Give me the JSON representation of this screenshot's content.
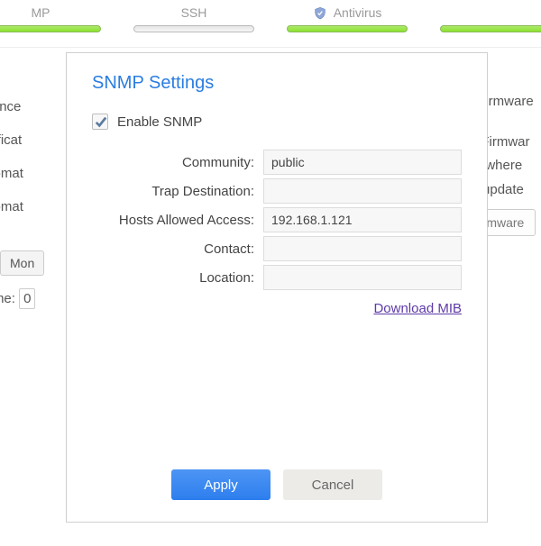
{
  "bg": {
    "tabs": [
      {
        "label": "MP",
        "bar": "green"
      },
      {
        "label": "SSH",
        "bar": "gray"
      },
      {
        "label": "Antivirus",
        "bar": "green",
        "icon": true
      },
      {
        "label": "",
        "bar": "green"
      }
    ],
    "left_items": [
      "tenance",
      "Notificat",
      "Automat",
      "Automat"
    ],
    "right_lines": [
      "all Firmware",
      "tall Firmwar",
      "tion where",
      "the update"
    ],
    "right_button": "Firmware",
    "day_pill": "Mon",
    "time_label": "Time:",
    "time_value": "0"
  },
  "modal": {
    "title": "SNMP Settings",
    "enable_label": "Enable SNMP",
    "enable_checked": true,
    "fields": {
      "community": {
        "label": "Community:",
        "value": "public"
      },
      "trap": {
        "label": "Trap Destination:",
        "value": ""
      },
      "hosts": {
        "label": "Hosts Allowed Access:",
        "value": "192.168.1.121"
      },
      "contact": {
        "label": "Contact:",
        "value": ""
      },
      "location": {
        "label": "Location:",
        "value": ""
      }
    },
    "download_link": "Download MIB",
    "apply_label": "Apply",
    "cancel_label": "Cancel"
  }
}
